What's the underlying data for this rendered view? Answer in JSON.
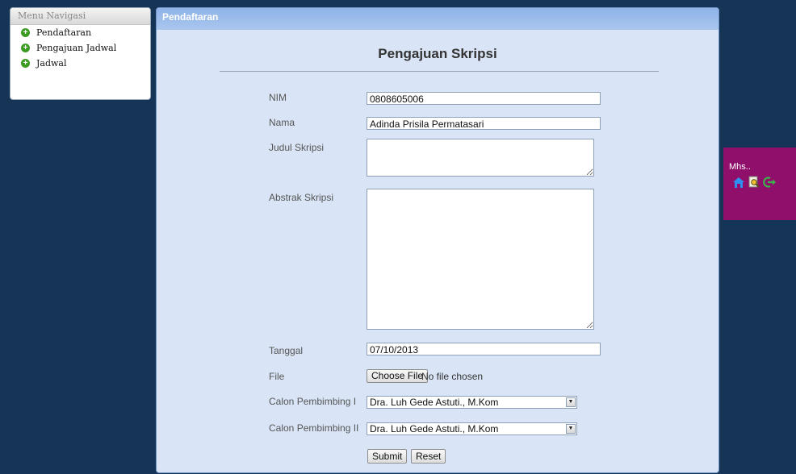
{
  "nav": {
    "header": "Menu Navigasi",
    "items": [
      {
        "label": "Pendaftaran",
        "icon": "plus-circle-icon"
      },
      {
        "label": "Pengajuan Jadwal",
        "icon": "plus-circle-icon"
      },
      {
        "label": "Jadwal",
        "icon": "plus-circle-icon"
      }
    ]
  },
  "panel": {
    "header": "Pendaftaran",
    "title": "Pengajuan Skripsi"
  },
  "form": {
    "nim": {
      "label": "NIM",
      "value": "0808605006"
    },
    "nama": {
      "label": "Nama",
      "value": "Adinda Prisila Permatasari"
    },
    "judul": {
      "label": "Judul Skripsi",
      "value": ""
    },
    "abstrak": {
      "label": "Abstrak Skripsi",
      "value": ""
    },
    "tanggal": {
      "label": "Tanggal",
      "value": "07/10/2013"
    },
    "file": {
      "label": "File",
      "button": "Choose File",
      "status": "No file chosen"
    },
    "pembimbing1": {
      "label": "Calon Pembimbing I",
      "selected": "Dra. Luh Gede Astuti., M.Kom"
    },
    "pembimbing2": {
      "label": "Calon Pembimbing II",
      "selected": "Dra. Luh Gede Astuti., M.Kom"
    },
    "submit": "Submit",
    "reset": "Reset"
  },
  "userbox": {
    "label": "Mhs..",
    "icons": [
      "home-icon",
      "search-document-icon",
      "logout-arrow-icon"
    ]
  },
  "colors": {
    "background": "#163556",
    "panel": "#d9e5f6",
    "panel_header": "#8fb3e8",
    "userbox": "#8f0f6b",
    "nav_plus": "#3c9c22"
  }
}
